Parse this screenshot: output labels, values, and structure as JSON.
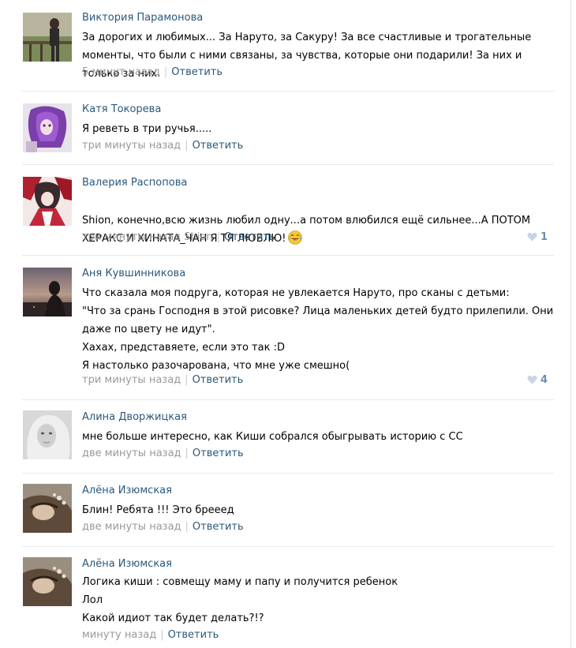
{
  "comments": [
    {
      "author": "Виктория Парамонова",
      "text": "За дорогих и любимых... За Наруто, за Сакуру! За все счастливые и трогательные моменты, что были с ними связаны, за чувства, которые они подарили! За них и только за них.",
      "time": "5 минут назад",
      "reply": "Ответить"
    },
    {
      "author": "Катя Токорева",
      "text": "Я реветь в три ручья.....",
      "time": "три минуты назад",
      "reply": "Ответить"
    },
    {
      "author": "Валерия Распопова",
      "text": "Shion, конечно,всю жизнь любил одну...а потом влюбился ещё сильнее...А ПОТОМ ХЕРАКС И ХИНАТА_ЧАН Я ТЯ ЛЮБЛЮ!",
      "time": "три минуты назад Shion",
      "reply": "Ответить",
      "likes": "1",
      "emoji": "crying-laughing-emoji"
    },
    {
      "author": "Аня Кувшинникова",
      "text": "Что сказала моя подруга, которая не увлекается Наруто, про сканы с детьми:\n\"Что за срань Господня в этой рисовке? Лица маленьких детей будто прилепили. Они даже по цвету не идут\".\nХахах, представяете, если это так :D\nЯ настолько разочарована, что мне уже смешно(",
      "time": "три минуты назад",
      "reply": "Ответить",
      "likes": "4"
    },
    {
      "author": "Алина Дворжицкая",
      "text": "мне больше интересно, как Киши собрался обыгрывать историю с СС",
      "time": "две минуты назад",
      "reply": "Ответить"
    },
    {
      "author": "Алёна Изюмская",
      "text": "Блин! Ребята !!! Это брееед",
      "time": "две минуты назад",
      "reply": "Ответить"
    },
    {
      "author": "Алёна Изюмская",
      "text": "Логика киши : совмещу маму и папу и получится ребенок\nЛол\nКакой идиот так будет делать?!?",
      "time": "минуту назад",
      "reply": "Ответить"
    }
  ],
  "colors": {
    "author": "#2b587a",
    "meta": "#999999",
    "like": "#6d8fb3",
    "divider": "#e7eaed"
  },
  "icons": {
    "like": "heart-icon"
  }
}
